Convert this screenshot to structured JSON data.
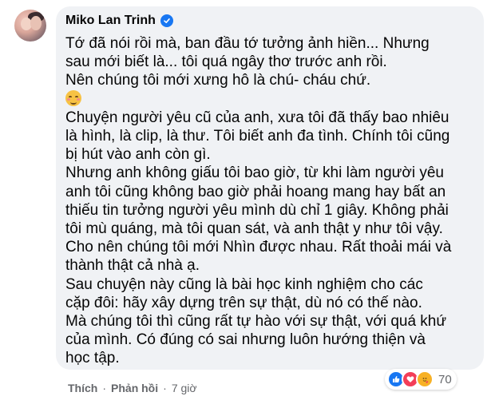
{
  "comment": {
    "author": "Miko Lan Trinh",
    "verified_icon": "verified-badge-icon",
    "lines": [
      "Tớ đã nói rồi mà, ban đầu tớ tưởng ảnh hiền... Nhưng",
      "sau mới biết là... tôi quá ngây thơ trước anh rồi.",
      "Nên chúng tôi mới xưng hô là chú- cháu chứ.",
      "Chuyện người yêu cũ của anh, xưa tôi đã thấy bao nhiêu",
      "là hình, là clip, là thư. Tôi biết anh đa tình. Chính tôi cũng",
      "bị hút vào anh còn gì.",
      "Nhưng anh không giấu tôi bao giờ, từ khi làm người yêu",
      "anh tôi cũng không bao giờ phải hoang mang hay bất an",
      "thiếu tin tưởng người yêu mình dù chỉ 1 giây. Không phải",
      "tôi mù quáng, mà tôi quan sát, và anh thật y như tôi vậy.",
      "Cho nên chúng tôi mới Nhìn được nhau. Rất thoải mái và",
      "thành thật cả nhà ạ.",
      "Sau chuyện này cũng là bài học kinh nghiệm cho các",
      "cặp đôi: hãy xây dựng trên sự thật, dù nó có thế nào.",
      "Mà chúng tôi thì cũng rất tự hào với sự thật, với quá khứ",
      "của mình. Có đúng có sai nhưng luôn hướng thiện và",
      "học tập."
    ],
    "emoji": "smiling-face-blush-emoji",
    "reactions": {
      "icons": [
        "like-reaction-icon",
        "love-reaction-icon",
        "care-reaction-icon"
      ],
      "count": "70"
    },
    "actions": {
      "like_label": "Thích",
      "separator": "·",
      "reply_label": "Phản hồi",
      "time": "7 giờ"
    }
  }
}
